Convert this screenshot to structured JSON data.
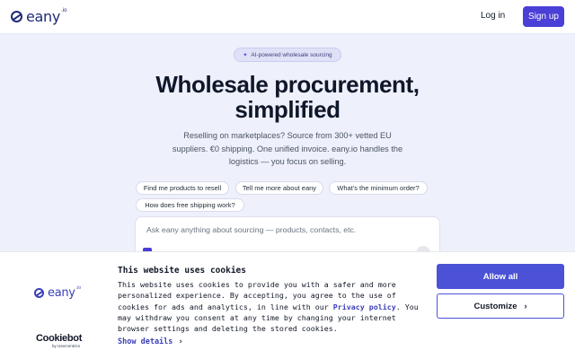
{
  "header": {
    "logo": "eany",
    "logo_sup": ".io",
    "login_label": "Log in",
    "signup_label": "Sign up"
  },
  "hero": {
    "badge": "AI-powered wholesale sourcing",
    "title": "Wholesale procurement, simplified",
    "subtitle": "Reselling on marketplaces? Source from 300+ vetted EU suppliers. €0 shipping. One unified invoice. eany.io handles the logistics — you focus on selling."
  },
  "chips": [
    "Find me products to resell",
    "Tell me more about eany",
    "What's the minimum order?",
    "How does free shipping work?"
  ],
  "ask": {
    "placeholder": "Ask eany anything about sourcing — products, contacts, etc."
  },
  "cookie": {
    "logo": "eany",
    "logo_sup": ".io",
    "cookiebot_name": "Cookiebot",
    "cookiebot_by": "by Usercentrics",
    "title": "This website uses cookies",
    "text_before": "This website uses cookies to provide you with a safer and more personalized experience. By accepting, you agree to the use of cookies for ads and analytics, in line with our ",
    "privacy_link": "Privacy policy",
    "text_after": ". You may withdraw you consent at any time by changing your internet browser settings and deleting the stored cookies.",
    "show_details": "Show details",
    "allow_all": "Allow all",
    "customize": "Customize"
  },
  "colors": {
    "accent": "#4a3fd6",
    "brand": "#1e2a78",
    "background": "#eef0fb"
  }
}
